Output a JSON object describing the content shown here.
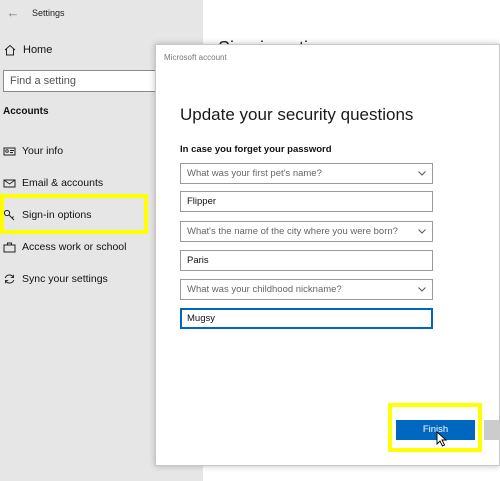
{
  "settings": {
    "title": "Settings",
    "back_icon": "back-arrow-icon",
    "home": {
      "label": "Home",
      "icon": "home-icon"
    },
    "search": {
      "placeholder": "Find a setting",
      "icon": "search-icon"
    },
    "section": "Accounts",
    "nav": [
      {
        "label": "Your info",
        "icon": "person-card-icon"
      },
      {
        "label": "Email & accounts",
        "icon": "envelope-icon"
      },
      {
        "label": "Sign-in options",
        "icon": "key-icon",
        "highlighted": true
      },
      {
        "label": "Access work or school",
        "icon": "briefcase-icon"
      },
      {
        "label": "Sync your settings",
        "icon": "sync-icon"
      }
    ],
    "page_title": "Sign-in options"
  },
  "dialog": {
    "caption": "Microsoft account",
    "heading": "Update your security questions",
    "subheading": "In case you forget your password",
    "questions": [
      {
        "question": "What was your first pet's name?",
        "answer": "Flipper"
      },
      {
        "question": "What's the name of the city where you were born?",
        "answer": "Paris"
      },
      {
        "question": "What was your childhood nickname?",
        "answer": "Mugsy"
      }
    ],
    "finish_label": "Finish"
  },
  "colors": {
    "accent": "#0067c0",
    "highlight": "#ffff00",
    "sidebar_bg": "#e6e6e6"
  }
}
